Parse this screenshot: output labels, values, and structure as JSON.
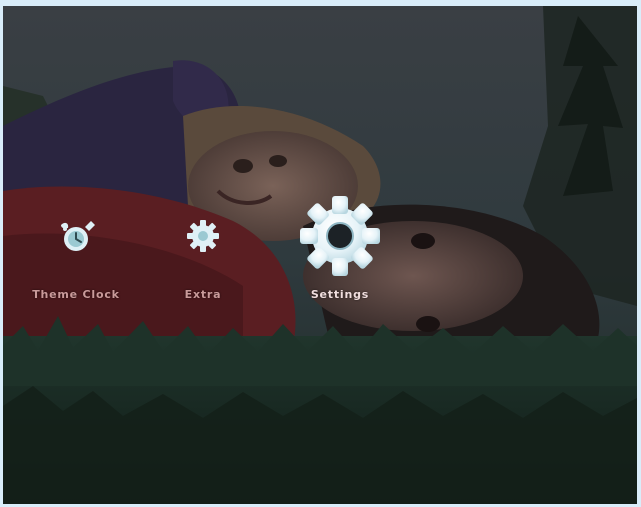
{
  "menu": {
    "items": [
      {
        "label": "Theme Clock",
        "icon": "theme-clock-icon",
        "selected": false
      },
      {
        "label": "Extra",
        "icon": "extra-gear-icon",
        "selected": false
      },
      {
        "label": "Settings",
        "icon": "settings-gear-icon",
        "selected": true
      }
    ]
  },
  "colors": {
    "frame": "#d9edfa",
    "icon": "#dff0f6",
    "label": "#c99a9a"
  }
}
